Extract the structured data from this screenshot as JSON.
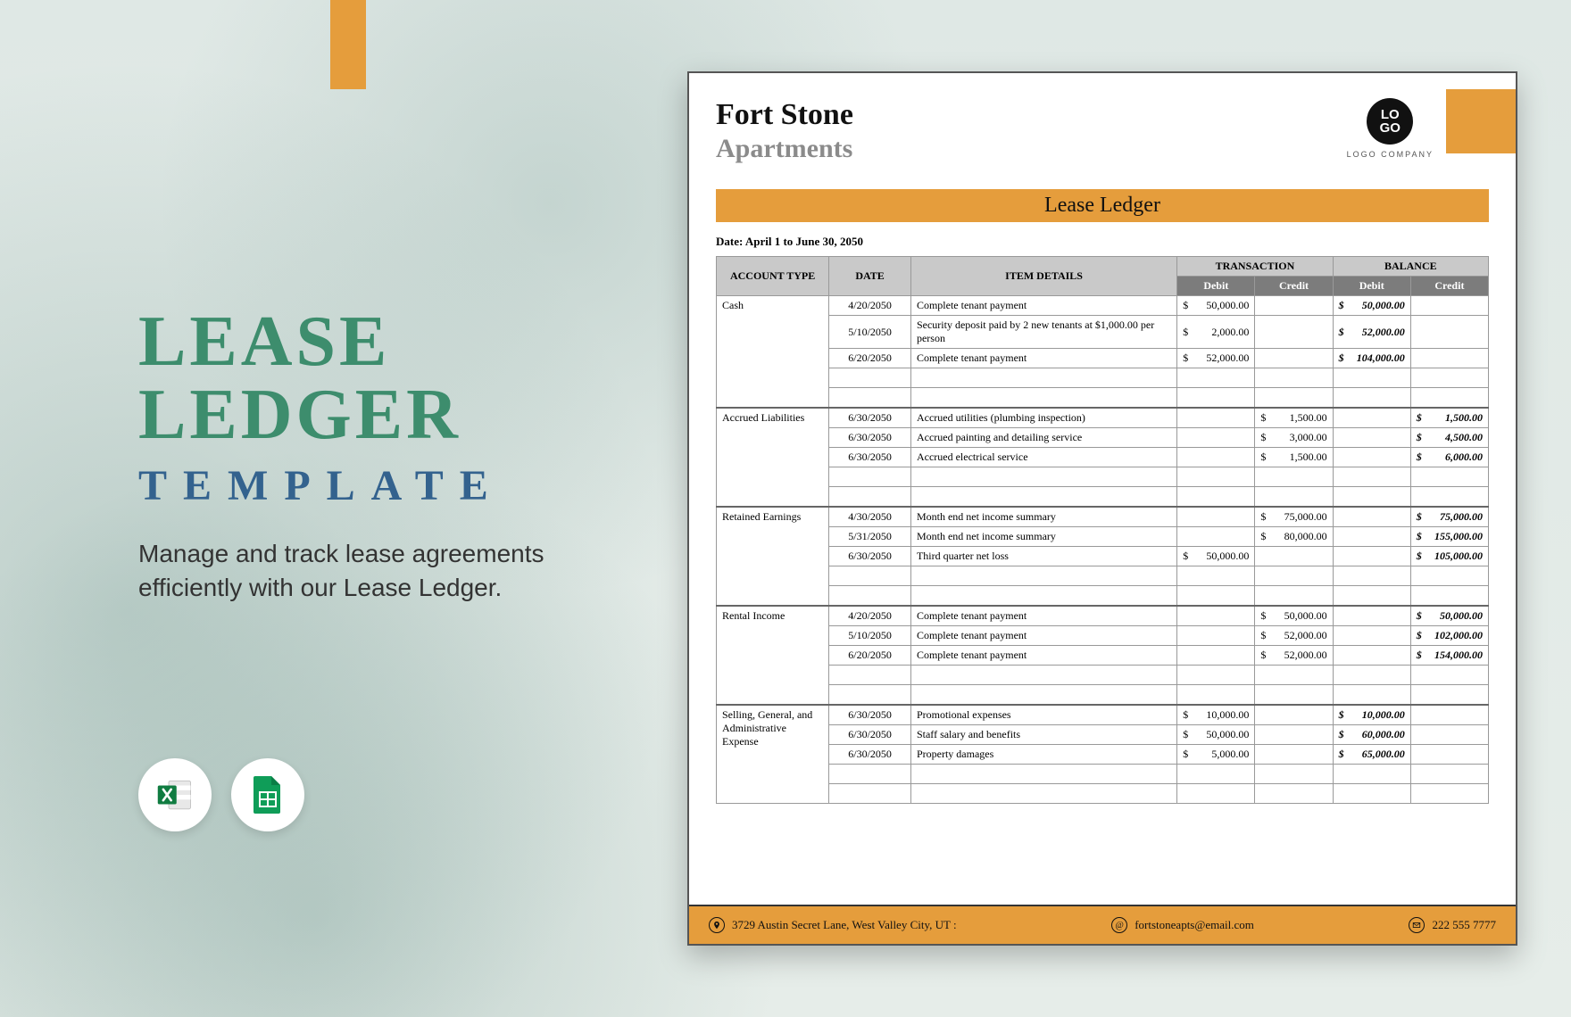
{
  "promo": {
    "title_line1": "LEASE",
    "title_line2": "LEDGER",
    "title_line3": "TEMPLATE",
    "subtitle": "Manage and track lease agreements efficiently with our Lease Ledger."
  },
  "doc": {
    "company_line1": "Fort Stone",
    "company_line2": "Apartments",
    "logo_text": "LO\nGO",
    "logo_caption": "LOGO COMPANY",
    "banner": "Lease Ledger",
    "date_line": "Date: April 1 to June 30, 2050",
    "headers": {
      "account_type": "ACCOUNT TYPE",
      "date": "DATE",
      "item_details": "ITEM DETAILS",
      "transaction": "TRANSACTION",
      "balance": "BALANCE",
      "debit": "Debit",
      "credit": "Credit"
    },
    "footer": {
      "address": "3729 Austin Secret Lane, West Valley City, UT :",
      "email": "fortstoneapts@email.com",
      "phone": "222 555 7777"
    }
  },
  "chart_data": {
    "type": "table",
    "title": "Lease Ledger",
    "columns": [
      "Account Type",
      "Date",
      "Item Details",
      "Transaction Debit",
      "Transaction Credit",
      "Balance Debit",
      "Balance Credit"
    ],
    "sections": [
      {
        "account": "Cash",
        "rows": [
          {
            "date": "4/20/2050",
            "item": "Complete tenant payment",
            "t_debit": "50,000.00",
            "t_credit": "",
            "b_debit": "50,000.00",
            "b_credit": ""
          },
          {
            "date": "5/10/2050",
            "item": "Security deposit paid by 2 new tenants at $1,000.00 per person",
            "t_debit": "2,000.00",
            "t_credit": "",
            "b_debit": "52,000.00",
            "b_credit": ""
          },
          {
            "date": "6/20/2050",
            "item": "Complete tenant payment",
            "t_debit": "52,000.00",
            "t_credit": "",
            "b_debit": "104,000.00",
            "b_credit": ""
          }
        ]
      },
      {
        "account": "Accrued Liabilities",
        "rows": [
          {
            "date": "6/30/2050",
            "item": "Accrued utilities (plumbing inspection)",
            "t_debit": "",
            "t_credit": "1,500.00",
            "b_debit": "",
            "b_credit": "1,500.00"
          },
          {
            "date": "6/30/2050",
            "item": "Accrued painting and detailing service",
            "t_debit": "",
            "t_credit": "3,000.00",
            "b_debit": "",
            "b_credit": "4,500.00"
          },
          {
            "date": "6/30/2050",
            "item": "Accrued electrical service",
            "t_debit": "",
            "t_credit": "1,500.00",
            "b_debit": "",
            "b_credit": "6,000.00"
          }
        ]
      },
      {
        "account": "Retained Earnings",
        "rows": [
          {
            "date": "4/30/2050",
            "item": "Month end net income summary",
            "t_debit": "",
            "t_credit": "75,000.00",
            "b_debit": "",
            "b_credit": "75,000.00"
          },
          {
            "date": "5/31/2050",
            "item": "Month end net income summary",
            "t_debit": "",
            "t_credit": "80,000.00",
            "b_debit": "",
            "b_credit": "155,000.00"
          },
          {
            "date": "6/30/2050",
            "item": "Third quarter net loss",
            "t_debit": "50,000.00",
            "t_credit": "",
            "b_debit": "",
            "b_credit": "105,000.00"
          }
        ]
      },
      {
        "account": "Rental Income",
        "rows": [
          {
            "date": "4/20/2050",
            "item": "Complete tenant payment",
            "t_debit": "",
            "t_credit": "50,000.00",
            "b_debit": "",
            "b_credit": "50,000.00"
          },
          {
            "date": "5/10/2050",
            "item": "Complete tenant payment",
            "t_debit": "",
            "t_credit": "52,000.00",
            "b_debit": "",
            "b_credit": "102,000.00"
          },
          {
            "date": "6/20/2050",
            "item": "Complete tenant payment",
            "t_debit": "",
            "t_credit": "52,000.00",
            "b_debit": "",
            "b_credit": "154,000.00"
          }
        ]
      },
      {
        "account": "Selling, General, and Administrative Expense",
        "rows": [
          {
            "date": "6/30/2050",
            "item": "Promotional expenses",
            "t_debit": "10,000.00",
            "t_credit": "",
            "b_debit": "10,000.00",
            "b_credit": ""
          },
          {
            "date": "6/30/2050",
            "item": "Staff salary and benefits",
            "t_debit": "50,000.00",
            "t_credit": "",
            "b_debit": "60,000.00",
            "b_credit": ""
          },
          {
            "date": "6/30/2050",
            "item": "Property damages",
            "t_debit": "5,000.00",
            "t_credit": "",
            "b_debit": "65,000.00",
            "b_credit": ""
          }
        ]
      }
    ]
  }
}
